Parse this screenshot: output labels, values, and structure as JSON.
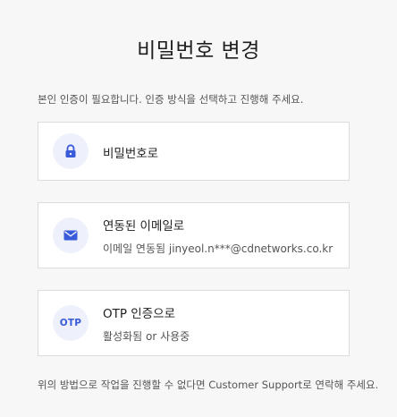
{
  "page": {
    "title": "비밀번호 변경",
    "intro": "본인 인증이 필요합니다. 인증 방식을 선택하고 진행해 주세요."
  },
  "options": {
    "password": {
      "label": "비밀번호로",
      "icon": "lock-icon"
    },
    "email": {
      "label": "연동된 이메일로",
      "detail": "이메일 연동됨  jinyeol.n***@cdnetworks.co.kr",
      "icon": "mail-icon"
    },
    "otp": {
      "label": "OTP 인증으로",
      "detail": "활성화됨 or 사용중",
      "icon_text": "OTP"
    }
  },
  "footer": {
    "text": "위의 방법으로 작업을 진행할 수 없다면 Customer Support로 연락해 주세요."
  },
  "colors": {
    "accent": "#3a5bd9",
    "icon_bg": "#eef1fb",
    "page_bg": "#f7f7f7",
    "card_border": "#dcdcdc"
  }
}
